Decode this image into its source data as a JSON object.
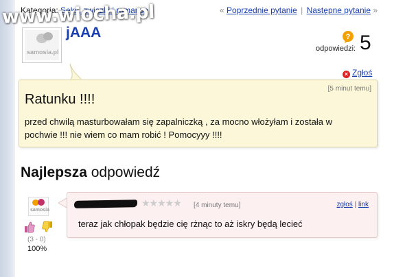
{
  "watermark": {
    "text": "www.wiocha.pl"
  },
  "breadcrumb": {
    "category_label": "Kategoria:",
    "category_link": "Seks, związki i romanse"
  },
  "nav": {
    "prev_arrow": "«",
    "prev_label": "Poprzednie pytanie",
    "separator": "|",
    "next_label": "Następne pytanie",
    "next_arrow": "»"
  },
  "asker": {
    "avatar_text": "samosia.pl",
    "username": "jAAA"
  },
  "answers": {
    "label": "odpowiedzi:",
    "count": "5",
    "badge_icon": "question-badge-icon"
  },
  "report": {
    "label": "Zgłoś",
    "icon": "close-icon"
  },
  "question": {
    "time": "[5 minut temu]",
    "title": "Ratunku !!!!",
    "body": "przed chwilą masturbowałam się zapalniczką , za mocno włożyłam i została w pochwie !!! nie wiem co mam robić ! Pomocyyy !!!!"
  },
  "best_answer": {
    "heading_bold": "Najlepsza",
    "heading_rest": " odpowiedź",
    "logo_text": "samosia",
    "votes": "(3 - 0)",
    "percent": "100%",
    "stars": "★★★★★",
    "rating": 0,
    "time": "[4 minuty temu]",
    "report_link": "zgłoś",
    "link_label": "link",
    "links_sep": "|",
    "body": "teraz jak chłopak będzie cię rżnąc to aż iskry będą lecieć"
  },
  "colors": {
    "link": "#1a3fb0",
    "question_bg": "#fbf7d8",
    "answer_bg": "#fdf0f0"
  }
}
